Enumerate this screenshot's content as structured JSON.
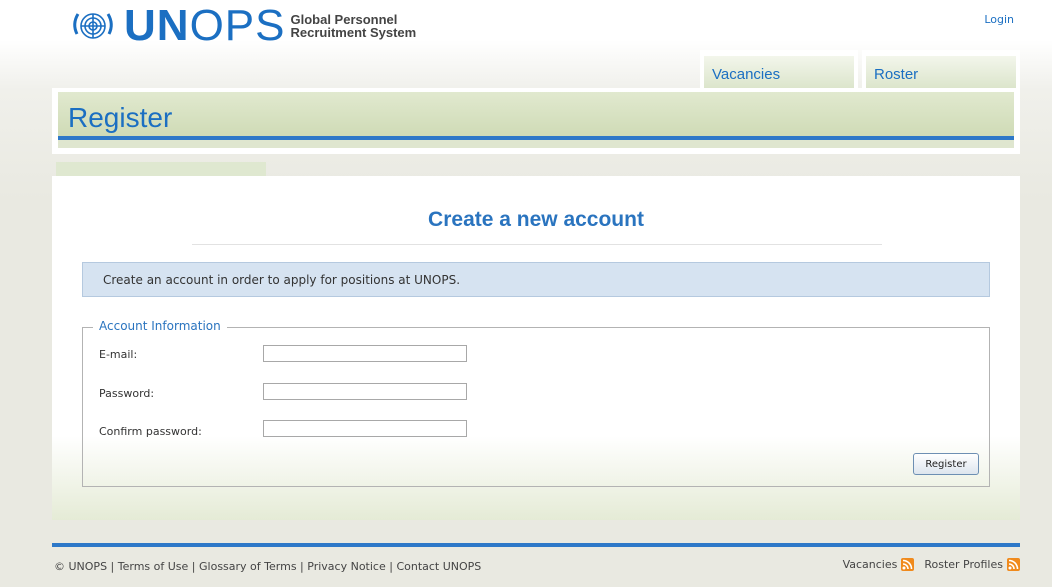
{
  "header": {
    "logo_word_bold": "UN",
    "logo_word_thin": "OPS",
    "logo_tagline_line1": "Global Personnel",
    "logo_tagline_line2": "Recruitment System",
    "login_label": "Login"
  },
  "nav": {
    "tabs": [
      {
        "label": "Vacancies"
      },
      {
        "label": "Roster"
      }
    ]
  },
  "banner": {
    "title": "Register"
  },
  "main": {
    "title": "Create a new account",
    "info_text": "Create an account in order to apply for positions at UNOPS.",
    "fieldset_legend": "Account Information",
    "fields": [
      {
        "label": "E-mail:",
        "value": ""
      },
      {
        "label": "Password:",
        "value": ""
      },
      {
        "label": "Confirm password:",
        "value": ""
      }
    ],
    "submit_label": "Register"
  },
  "footer": {
    "copyright": "© UNOPS",
    "links": [
      "Terms of Use",
      "Glossary of Terms",
      "Privacy Notice",
      "Contact UNOPS"
    ],
    "feeds": [
      {
        "label": "Vacancies",
        "icon": "rss-icon"
      },
      {
        "label": "Roster Profiles",
        "icon": "rss-icon"
      }
    ]
  },
  "colors": {
    "brand_blue": "#1b6fc2",
    "accent_line": "#2d78c8",
    "banner_green": "#d9e3c7",
    "info_box": "#d6e3f1",
    "rss_orange": "#f08a1c"
  }
}
